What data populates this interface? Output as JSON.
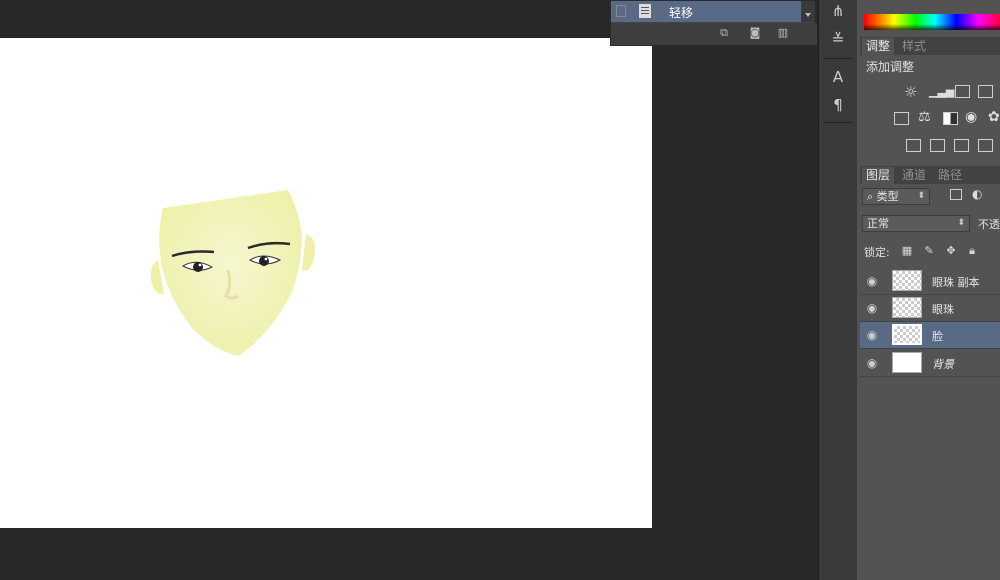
{
  "history": {
    "item_label": "轻移"
  },
  "tool_strip": {
    "tools": [
      "brush-presets-icon",
      "brush-settings-icon",
      "character-icon",
      "paragraph-icon"
    ],
    "character_glyph": "A",
    "paragraph_glyph": "¶"
  },
  "adjustments_panel": {
    "tabs": [
      {
        "label": "调整",
        "active": true
      },
      {
        "label": "样式",
        "active": false
      }
    ],
    "title": "添加调整"
  },
  "layers_panel": {
    "tabs": [
      {
        "label": "图层",
        "active": true
      },
      {
        "label": "通道",
        "active": false
      },
      {
        "label": "路径",
        "active": false
      }
    ],
    "filter_label": "⌕ 类型",
    "blend_mode": "正常",
    "opacity_label": "不透",
    "lock_label": "锁定:",
    "layers": [
      {
        "name": "眼珠 副本",
        "selected": false
      },
      {
        "name": "眼珠",
        "selected": false
      },
      {
        "name": "脸",
        "selected": true
      },
      {
        "name": "背景",
        "selected": false
      }
    ]
  },
  "colors": {
    "selection": "#596a86",
    "panel_bg": "#535353",
    "workspace_bg": "#282828",
    "face_fill": "#f3f3b8"
  }
}
